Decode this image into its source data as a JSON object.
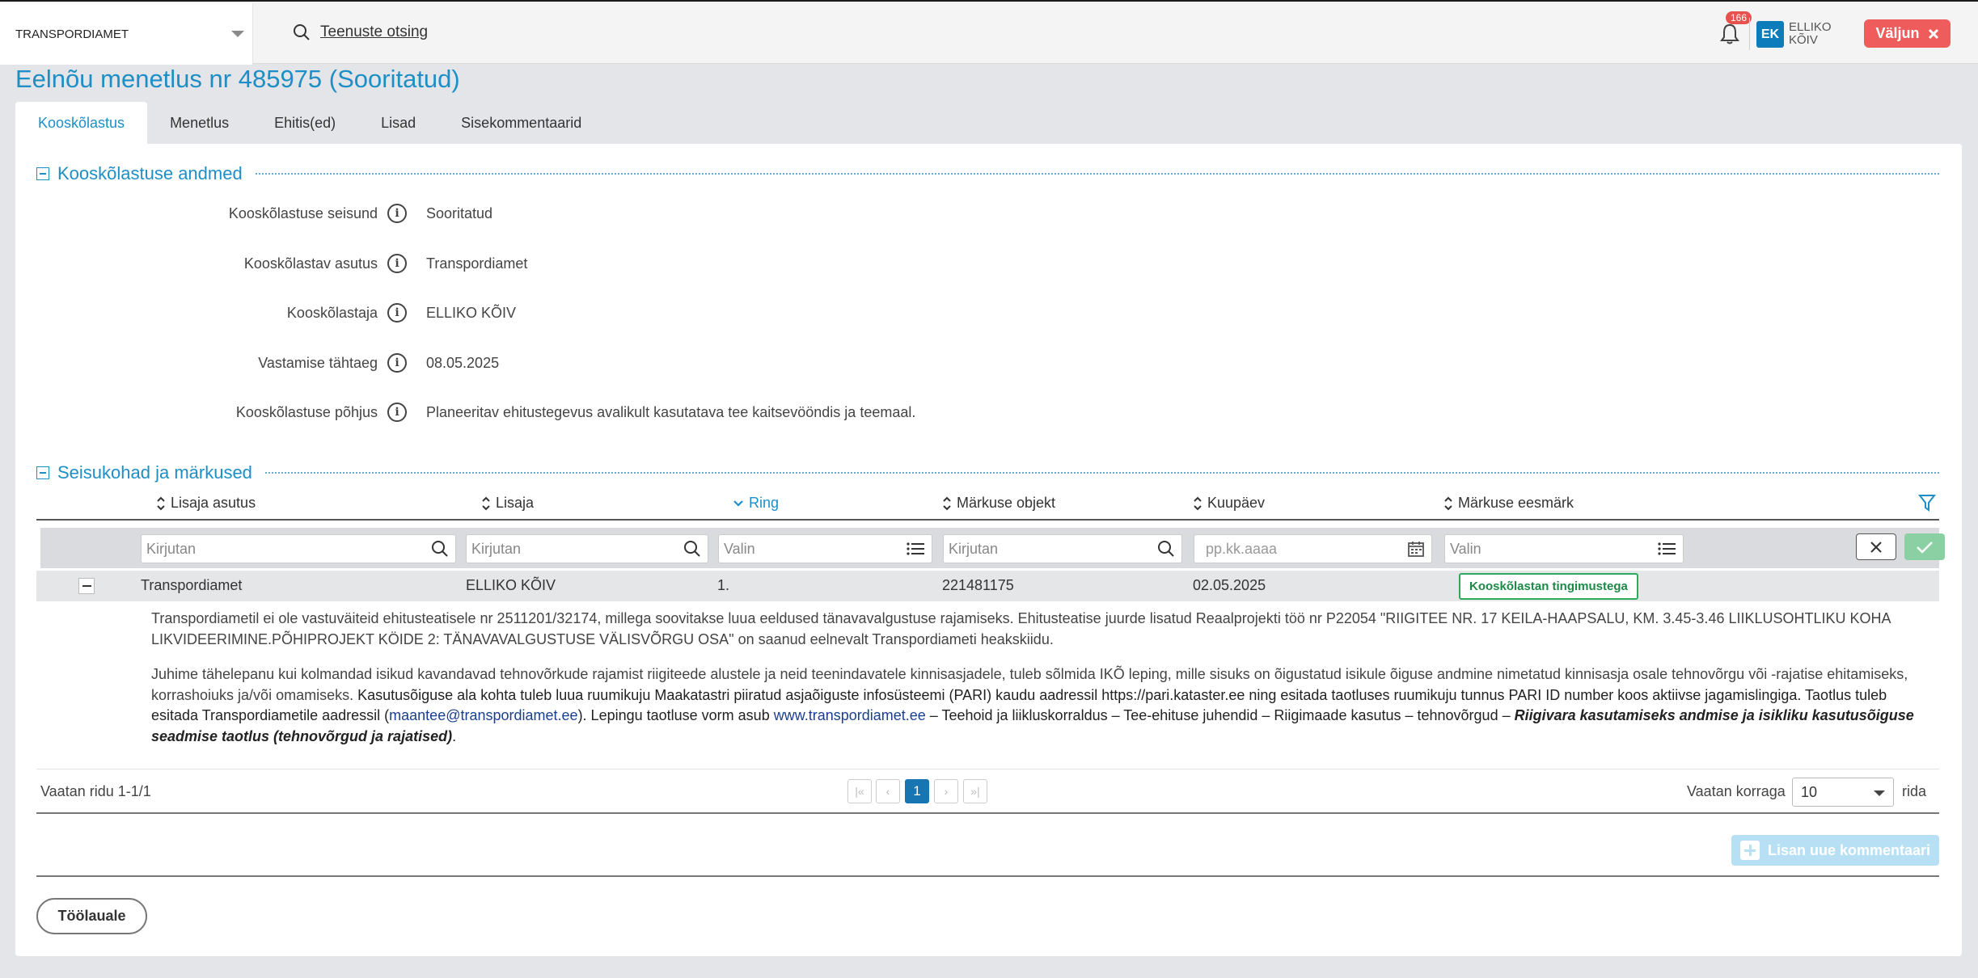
{
  "header": {
    "org_select": "TRANSPORDIAMET",
    "search_label": "Teenuste otsing",
    "notifications_count": "166",
    "user_initials": "EK",
    "user_name": "ELLIKO KÕIV",
    "logout_label": "Väljun"
  },
  "page": {
    "title": "Eelnõu menetlus nr 485975 (Sooritatud)"
  },
  "tabs": [
    {
      "label": "Kooskõlastus",
      "active": true
    },
    {
      "label": "Menetlus",
      "active": false
    },
    {
      "label": "Ehitis(ed)",
      "active": false
    },
    {
      "label": "Lisad",
      "active": false
    },
    {
      "label": "Sisekommentaarid",
      "active": false
    }
  ],
  "details_section": {
    "title": "Kooskõlastuse andmed",
    "fields": [
      {
        "label": "Kooskõlastuse seisund",
        "value": "Sooritatud"
      },
      {
        "label": "Kooskõlastav asutus",
        "value": "Transpordiamet"
      },
      {
        "label": "Kooskõlastaja",
        "value": "ELLIKO KÕIV"
      },
      {
        "label": "Vastamise tähtaeg",
        "value": "08.05.2025"
      },
      {
        "label": "Kooskõlastuse põhjus",
        "value": "Planeeritav ehitustegevus avalikult kasutatava tee kaitsevööndis ja teemaal."
      }
    ]
  },
  "remarks_section": {
    "title": "Seisukohad ja märkused",
    "columns": [
      "Lisaja asutus",
      "Lisaja",
      "Ring",
      "Märkuse objekt",
      "Kuupäev",
      "Märkuse eesmärk"
    ],
    "filters": {
      "agency_placeholder": "Kirjutan",
      "author_placeholder": "Kirjutan",
      "round_placeholder": "Valin",
      "object_placeholder": "Kirjutan",
      "date_placeholder": "pp.kk.aaaa",
      "purpose_placeholder": "Valin"
    },
    "rows": [
      {
        "agency": "Transpordiamet",
        "author": "ELLIKO KÕIV",
        "round": "1.",
        "object": "221481175",
        "date": "02.05.2025",
        "purpose": "Kooskõlastan tingimustega"
      }
    ],
    "comment": {
      "p1": "Transpordiametil ei ole vastuväiteid ehitusteatisele nr 2511201/32174, millega soovitakse luua eeldused tänavavalgustuse rajamiseks. Ehitusteatise juurde lisatud Reaalprojekti töö nr P22054 \"RIIGITEE NR. 17 KEILA-HAAPSALU, KM. 3.45-3.46 LIIKLUSOHTLIKU KOHA LIKVIDEERIMINE.PÕHIPROJEKT KÖIDE 2: TÄNAVAVALGUSTUSE VÄLISVÕRGU OSA\" on saanud eelnevalt Transpordiameti heakskiidu.",
      "p2_a": "Juhime tähelepanu kui kolmandad isikud kavandavad tehnovõrkude rajamist riigiteede alustele ja neid teenindavatele kinnisasjadele, tuleb sõlmida IKÕ leping, mille sisuks on õigustatud isikule õiguse andmine nimetatud kinnisasja osale tehnovõrgu või -rajatise ehitamiseks, korrashoiuks ja/või omamiseks.",
      "p2_b": " Kasutusõiguse ala kohta tuleb luua ruumikuju Maakatastri piiratud asjaõiguste infosüsteemi (PARI) kaudu aadressil https://pari.kataster.ee ning esitada taotluses ruumikuju tunnus PARI ID number koos aktiivse jagamislingiga. Taotlus tuleb esitada Transpordiametile aadressil (",
      "email": "maantee@transpordiamet.ee",
      "p2_c": "). Lepingu taotluse vorm asub ",
      "link": "www.transpordiamet.ee",
      "p2_d": " – Teehoid ja liikluskorraldus – Tee-ehituse juhendid – Riigimaade kasutus – tehnovõrgud – ",
      "p2_bold": "Riigivara kasutamiseks andmise ja isikliku kasutusõiguse seadmise taotlus (tehnovõrgud ja rajatised)",
      "p2_end": "."
    },
    "pagination": {
      "info": "Vaatan ridu 1-1/1",
      "current_page": "1",
      "per_page_label": "Vaatan korraga",
      "per_page_value": "10",
      "per_page_suffix": "rida"
    },
    "add_comment_label": "Lisan uue kommentaari"
  },
  "footer": {
    "back_label": "Töölauale"
  },
  "colors": {
    "accent": "#1d8fc6",
    "logout": "#ee5c5c",
    "badge_green": "#2eaa5f"
  }
}
